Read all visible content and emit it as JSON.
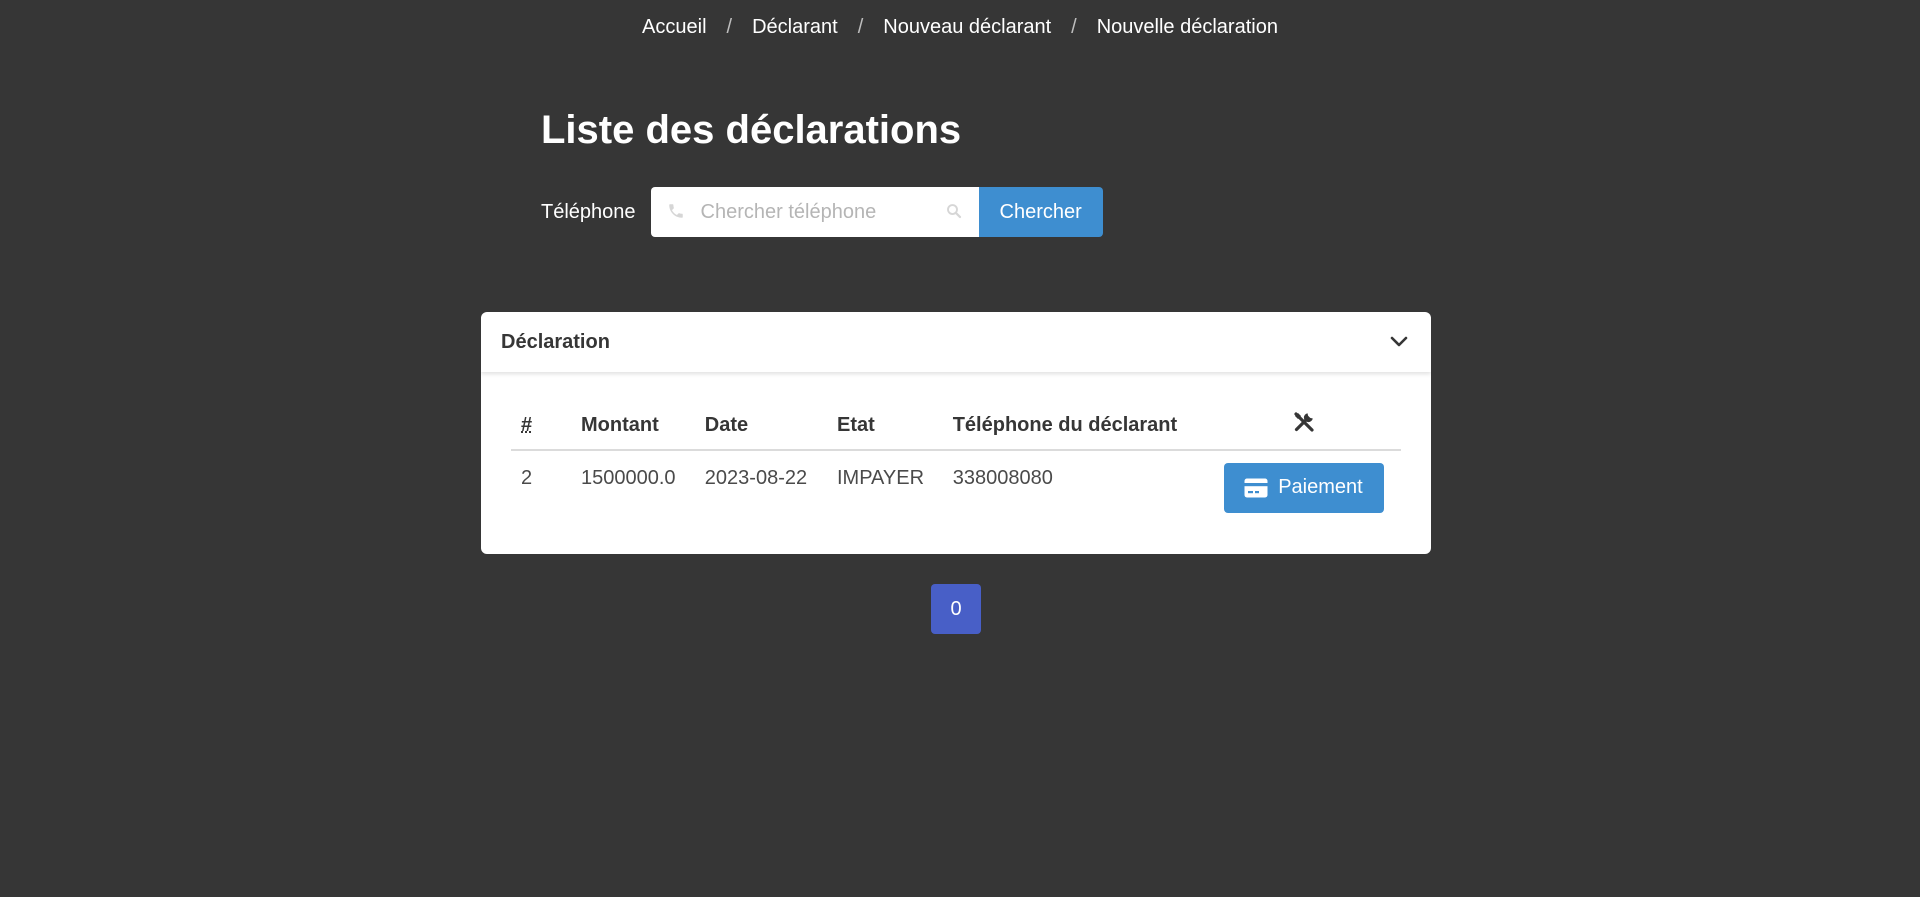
{
  "breadcrumb": {
    "items": [
      "Accueil",
      "Déclarant",
      "Nouveau déclarant",
      "Nouvelle déclaration"
    ],
    "separator": "/"
  },
  "page": {
    "title": "Liste des déclarations"
  },
  "search": {
    "label": "Téléphone",
    "placeholder": "Chercher téléphone",
    "value": "",
    "button_label": "Chercher",
    "left_icon": "phone-icon",
    "right_icon": "search-icon"
  },
  "card": {
    "title": "Déclaration",
    "toggle_icon": "chevron-down-icon",
    "table": {
      "columns": [
        "#",
        "Montant",
        "Date",
        "Etat",
        "Téléphone du déclarant"
      ],
      "actions_icon": "tools-icon",
      "rows": [
        {
          "id": "2",
          "montant": "1500000.0",
          "date": "2023-08-22",
          "etat": "IMPAYER",
          "telephone": "338008080",
          "action_label": "Paiement",
          "action_icon": "credit-card-icon"
        }
      ]
    }
  },
  "pagination": {
    "current": "0"
  },
  "colors": {
    "background": "#363636",
    "primary": "#3e8ed0",
    "pagination_active": "#485fc7",
    "card": "#ffffff"
  }
}
